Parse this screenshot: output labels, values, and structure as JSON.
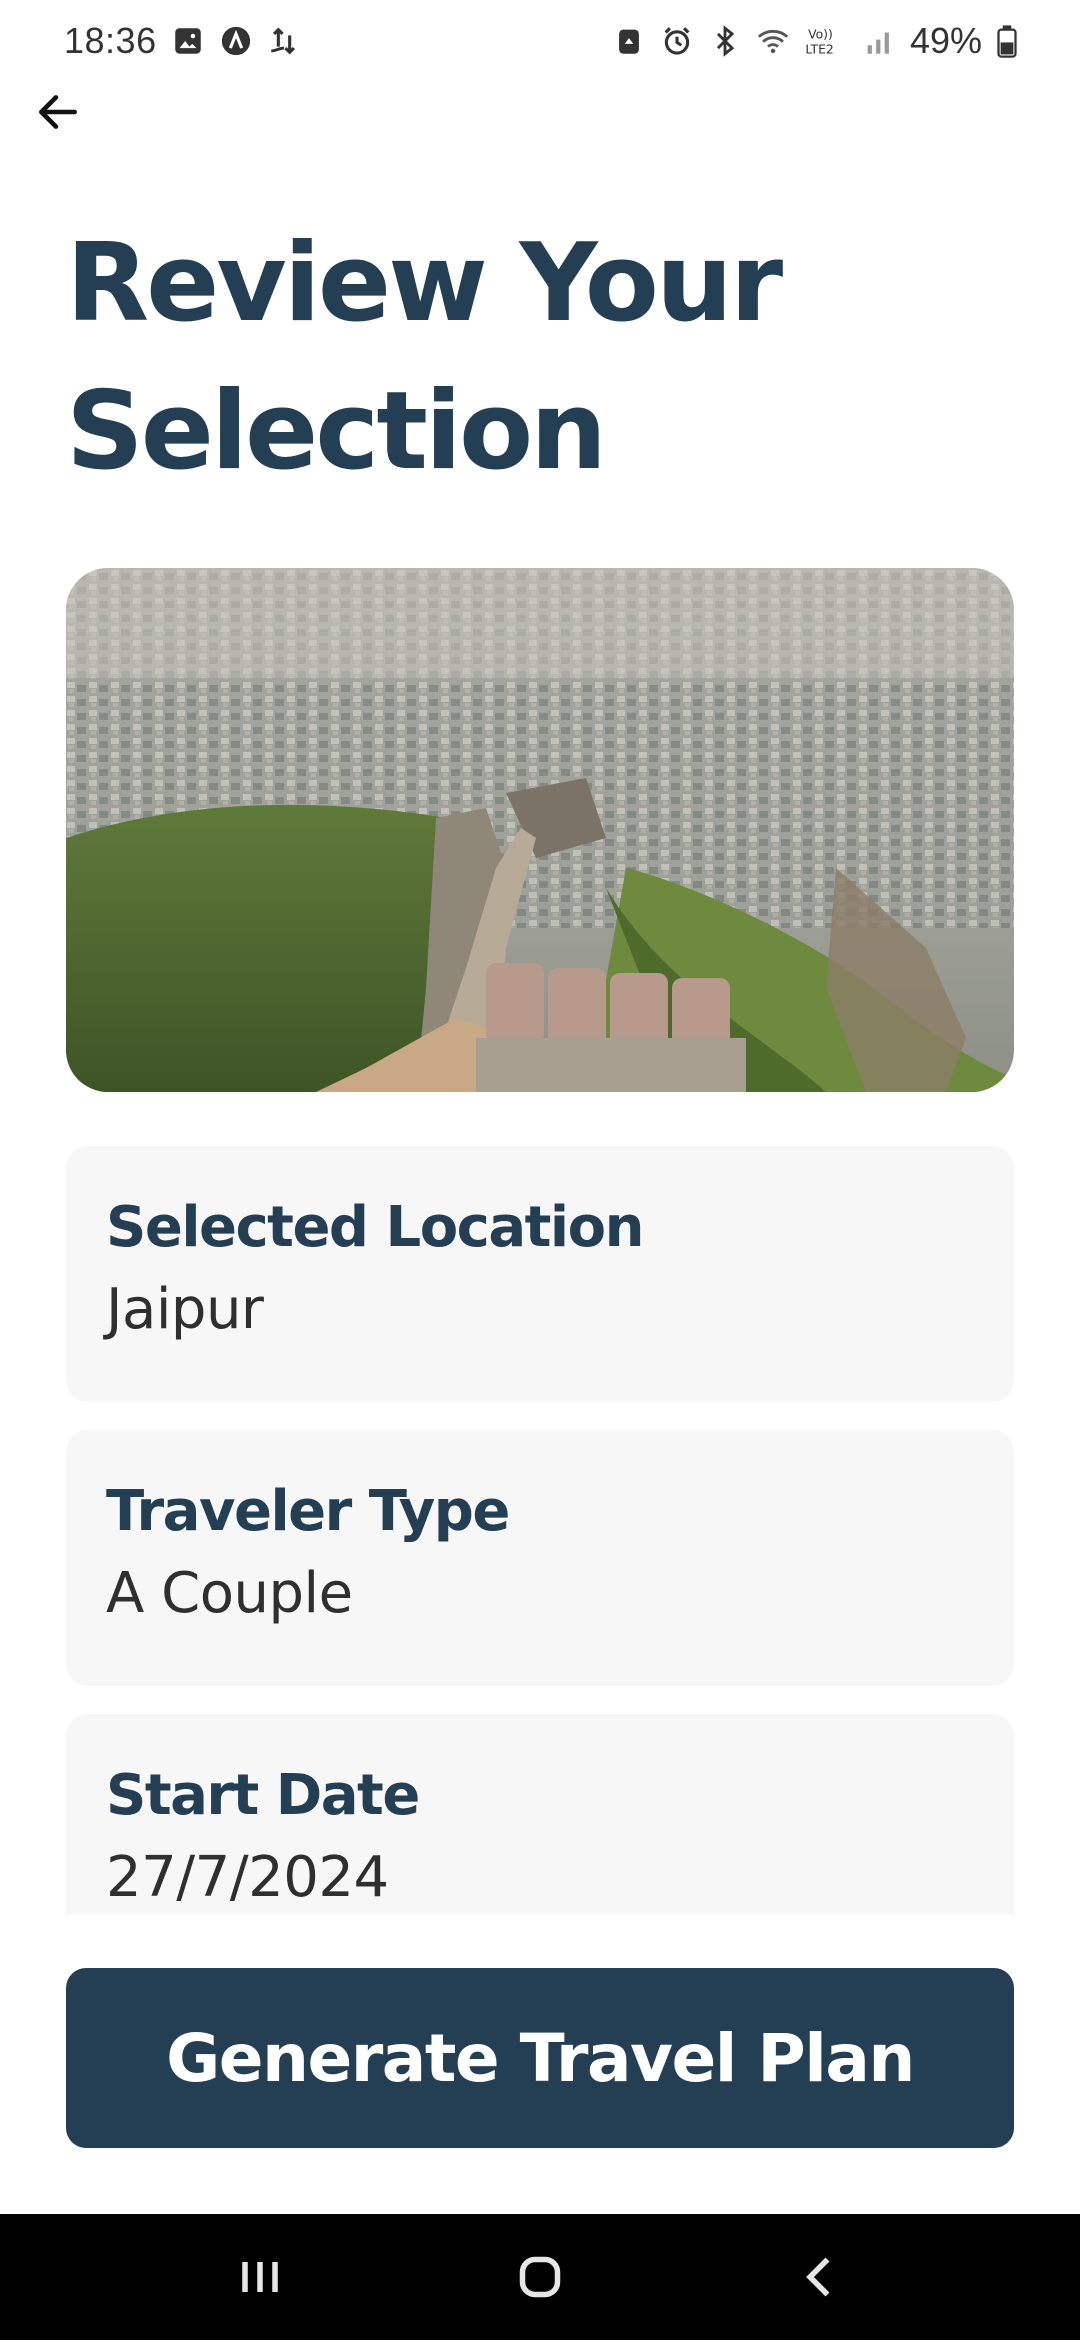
{
  "status_bar": {
    "time": "18:36",
    "battery": "49%",
    "left_icons": [
      "gallery-icon",
      "a-circle-icon",
      "transfer-icon"
    ],
    "right_icons": [
      "recycle-icon",
      "alarm-icon",
      "bluetooth-icon",
      "wifi-icon",
      "volte-icon",
      "signal-icon",
      "battery-icon"
    ]
  },
  "header": {
    "back_icon": "arrow-left-icon",
    "title": "Review Your Selection"
  },
  "summary": {
    "items": [
      {
        "label": "Selected Location",
        "value": "Jaipur"
      },
      {
        "label": "Traveler Type",
        "value": "A Couple"
      },
      {
        "label": "Start Date",
        "value": "27/7/2024"
      }
    ]
  },
  "actions": {
    "generate_label": "Generate Travel Plan"
  },
  "colors": {
    "primary": "#243e54",
    "card_bg": "#f7f7f7",
    "nav_bg": "#000000"
  }
}
